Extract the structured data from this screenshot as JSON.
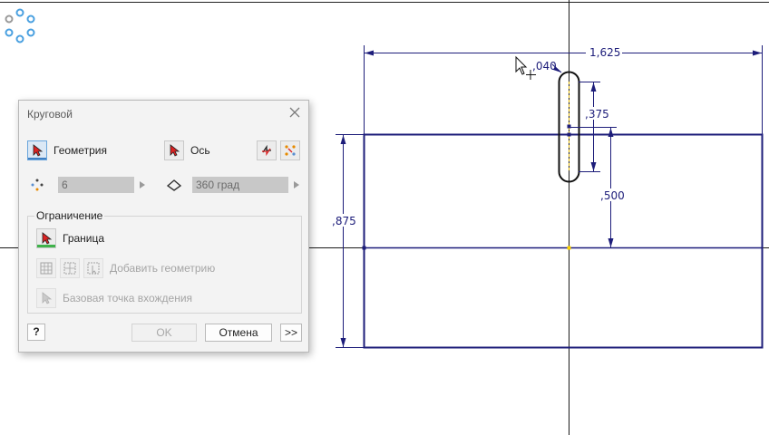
{
  "dialog": {
    "title": "Круговой",
    "geometry_label": "Геометрия",
    "axis_label": "Ось",
    "count_value": "6",
    "angle_value": "360 град",
    "constraint_group": "Ограничение",
    "boundary_label": "Граница",
    "add_geometry_label": "Добавить геометрию",
    "base_point_label": "Базовая точка вхождения",
    "ok_label": "OK",
    "cancel_label": "Отмена",
    "more_label": ">>",
    "help_label": "?"
  },
  "dimensions": {
    "slot_width": ",040",
    "overall_width": "1,625",
    "slot_length": ",375",
    "slot_offset": ",500",
    "overall_height": ",875"
  },
  "colors": {
    "sketch": "#1d1d7a",
    "axis": "#1a1a1a",
    "center_mark": "#ffd400",
    "spinner": "#4aa0e0",
    "active_button": "#3f7fc3",
    "boundary_bar": "#3fb24a"
  }
}
